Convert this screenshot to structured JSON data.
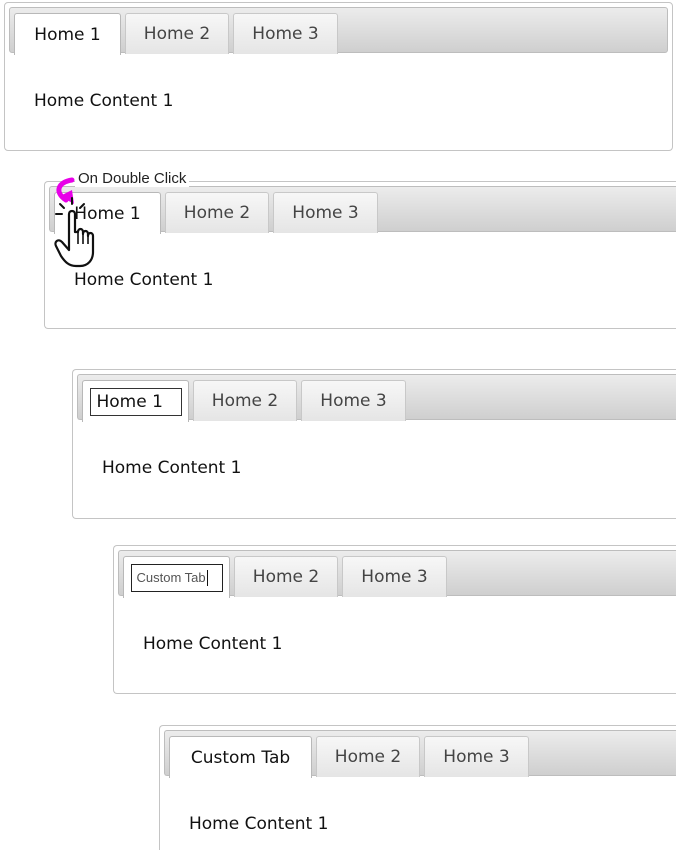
{
  "panels": [
    {
      "tabs": [
        "Home 1",
        "Home 2",
        "Home 3"
      ],
      "content": "Home Content 1"
    },
    {
      "caption": "On Double Click",
      "tabs": [
        "Home 1",
        "Home 2",
        "Home 3"
      ],
      "content": "Home Content 1"
    },
    {
      "tabs": [
        "Home 1",
        "Home 2",
        "Home 3"
      ],
      "content": "Home Content 1"
    },
    {
      "edit_value": "Custom Tab",
      "tabs": [
        "Custom Tab",
        "Home 2",
        "Home 3"
      ],
      "content": "Home Content 1"
    },
    {
      "tabs": [
        "Custom Tab",
        "Home 2",
        "Home 3"
      ],
      "content": "Home Content 1"
    }
  ],
  "icons": {
    "arrow": "curved-arrow-icon",
    "cursor": "hand-pointer-icon",
    "arrow_color": "#e800e8"
  }
}
